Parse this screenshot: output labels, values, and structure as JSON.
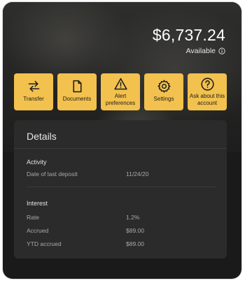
{
  "account": {
    "balance": "$6,737.24",
    "available_label": "Available"
  },
  "actions": [
    {
      "label": "Transfer",
      "icon": "transfer-icon"
    },
    {
      "label": "Documents",
      "icon": "document-icon"
    },
    {
      "label": "Alert preferences",
      "icon": "alert-icon"
    },
    {
      "label": "Settings",
      "icon": "gear-icon"
    },
    {
      "label": "Ask about this account",
      "icon": "question-icon"
    }
  ],
  "details": {
    "title": "Details",
    "activity": {
      "title": "Activity",
      "rows": [
        {
          "label": "Date of last deposit",
          "value": "11/24/20"
        }
      ]
    },
    "interest": {
      "title": "Interest",
      "rows": [
        {
          "label": "Rate",
          "value": "1.2%"
        },
        {
          "label": "Accrued",
          "value": "$89.00"
        },
        {
          "label": "YTD accrued",
          "value": "$89.00"
        }
      ]
    }
  },
  "colors": {
    "accent": "#f2c14e",
    "background": "#1a1a1a",
    "panel": "#2b2b2b"
  }
}
